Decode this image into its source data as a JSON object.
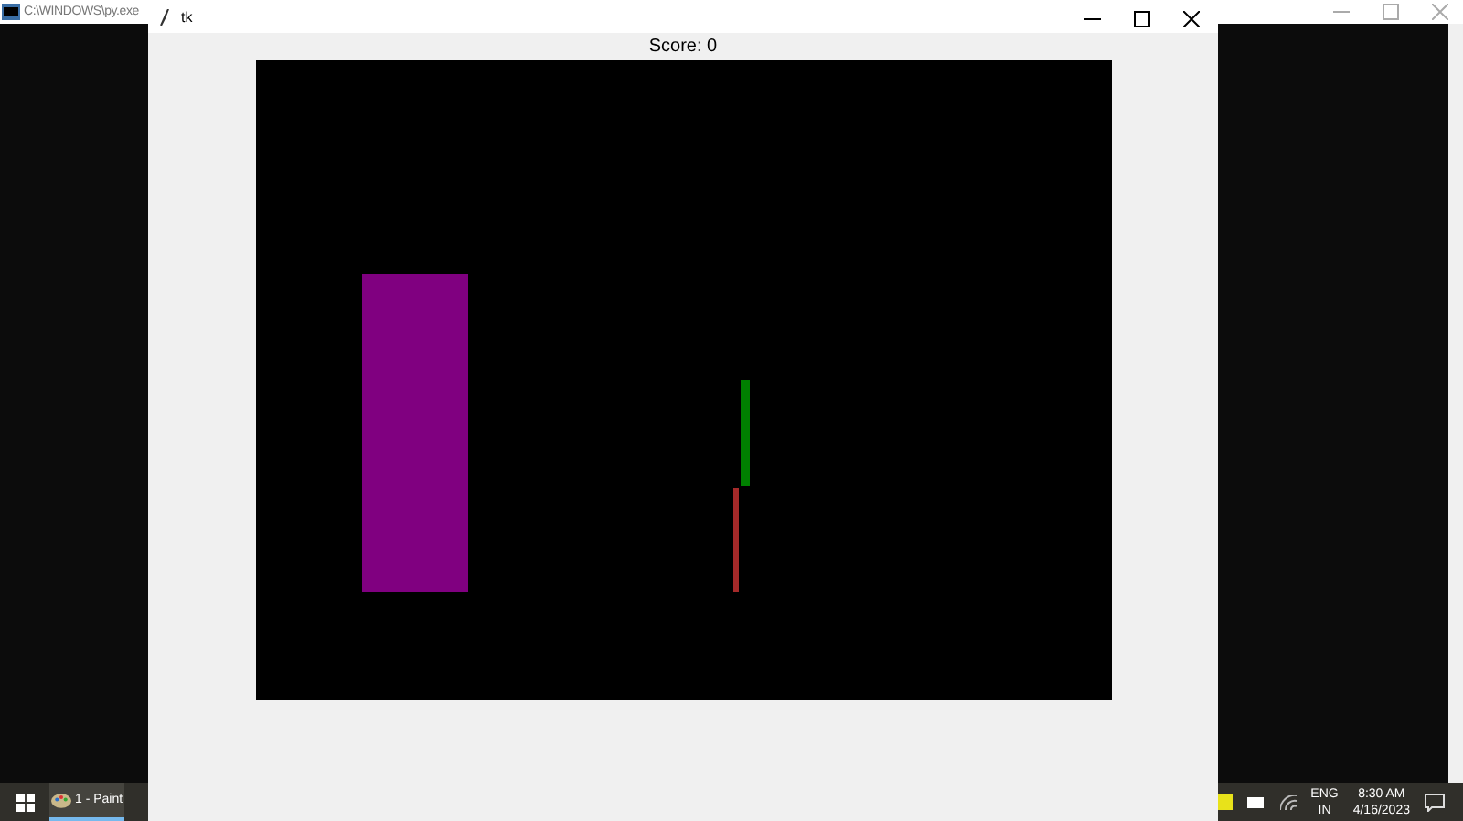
{
  "console_window": {
    "title": "C:\\WINDOWS\\py.exe"
  },
  "tk_window": {
    "title": "tk",
    "score": "Score: 0",
    "shapes": [
      {
        "color": "#800080"
      },
      {
        "color": "#008000"
      },
      {
        "color": "#a52a2a"
      }
    ]
  },
  "taskbar": {
    "apps": [
      {
        "label": "1 - Paint",
        "selected": true
      }
    ],
    "language": "ENG",
    "region": "IN",
    "time": "8:30 AM",
    "date": "4/16/2023"
  }
}
